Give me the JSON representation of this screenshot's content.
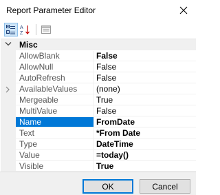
{
  "window": {
    "title": "Report Parameter Editor"
  },
  "toolbar": {
    "categorized_icon": "categorized-icon",
    "alphabetical_icon": "alphabetical-sort-icon",
    "property_pages_icon": "property-pages-icon"
  },
  "grid": {
    "category": "Misc",
    "rows": [
      {
        "name": "AllowBlank",
        "value": "False",
        "bold": true
      },
      {
        "name": "AllowNull",
        "value": "False",
        "bold": false
      },
      {
        "name": "AutoRefresh",
        "value": "False",
        "bold": false
      },
      {
        "name": "AvailableValues",
        "value": "(none)",
        "bold": false,
        "expandable": true
      },
      {
        "name": "Mergeable",
        "value": "True",
        "bold": false
      },
      {
        "name": "MultiValue",
        "value": "False",
        "bold": false
      },
      {
        "name": "Name",
        "value": "FromDate",
        "bold": true,
        "selected": true
      },
      {
        "name": "Text",
        "value": "*From Date",
        "bold": true
      },
      {
        "name": "Type",
        "value": "DateTime",
        "bold": true
      },
      {
        "name": "Value",
        "value": "=today()",
        "bold": true
      },
      {
        "name": "Visible",
        "value": "True",
        "bold": true
      }
    ]
  },
  "buttons": {
    "ok": "OK",
    "cancel": "Cancel"
  },
  "colors": {
    "selection": "#0078d7",
    "category_bg": "#f0f0f0",
    "name_text": "#555555"
  }
}
